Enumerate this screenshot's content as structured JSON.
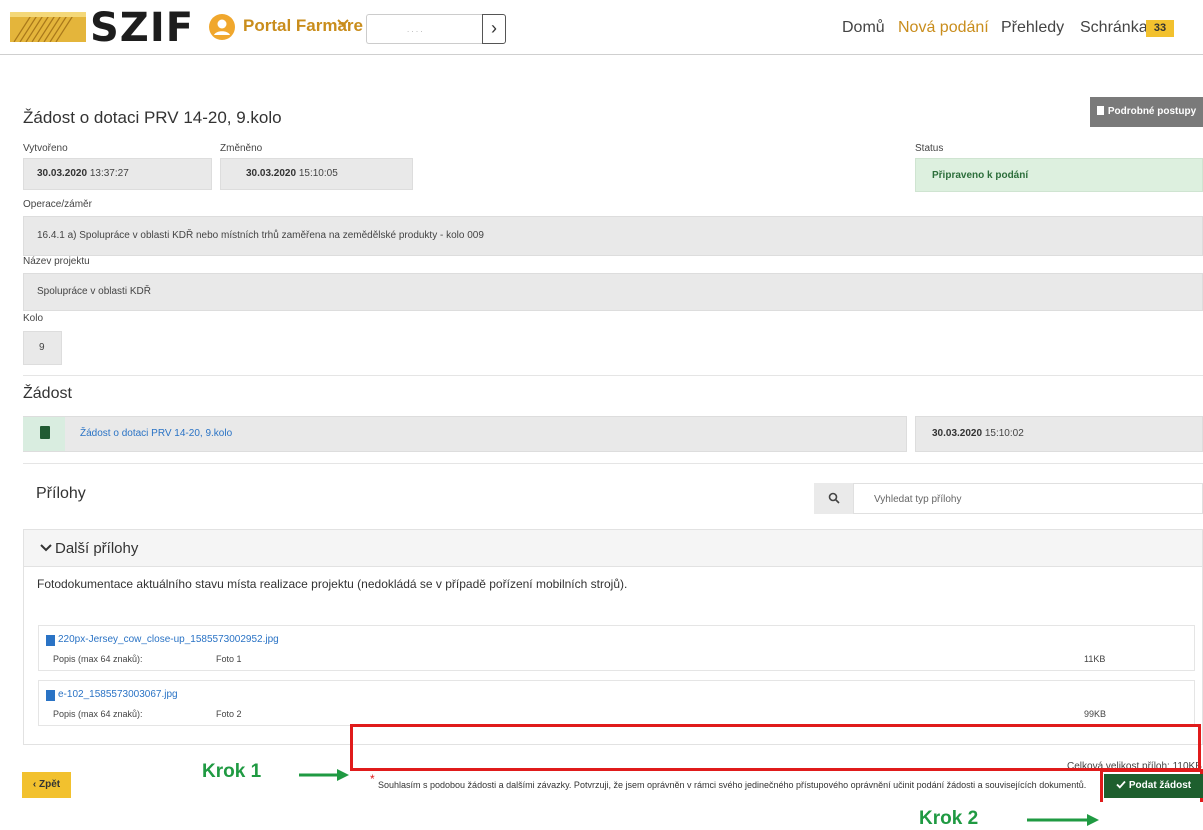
{
  "header": {
    "brand": "SZIF",
    "portal_label": "Portal Farmare",
    "portal_chevron": "chevron-down-icon",
    "search_placeholder": ". . . .",
    "go_icon": "chevron-right-icon",
    "nav": [
      "Domů",
      "Nová podání",
      "Přehledy",
      "Schránka"
    ],
    "active_nav": "Nová podání",
    "inbox_count": "33",
    "colors": {
      "brand_gold": "#c98d1c",
      "badge": "#f2c12e"
    }
  },
  "prv_button": "Podrobné postupy PRV",
  "page_title": "Žádost o dotaci PRV 14-20, 9.kolo",
  "meta": {
    "created_label": "Vytvořeno",
    "created_date": "30.03.2020",
    "created_time": "13:37:27",
    "changed_label": "Změněno",
    "changed_date": "30.03.2020",
    "changed_time": "15:10:05",
    "status_label": "Status",
    "status_value": "Připraveno k podání",
    "operation_label": "Operace/záměr",
    "operation_value": "16.4.1 a) Spolupráce v oblasti KDŘ nebo místních trhů zaměřena na zemědělské produkty - kolo 009",
    "project_label": "Název projektu",
    "project_value": "Spolupráce v oblasti KDŘ",
    "round_label": "Kolo",
    "round_value": "9"
  },
  "application": {
    "heading": "Žádost",
    "doc_link": "Žádost o dotaci PRV 14-20, 9.kolo",
    "doc_date": "30.03.2020",
    "doc_time": "15:10:02"
  },
  "attachments": {
    "heading": "Přílohy",
    "search_placeholder": "Vyhledat typ přílohy",
    "panel_title": "Další přílohy",
    "description": "Fotodokumentace aktuálního stavu místa realizace projektu (nedokládá se v případě pořízení mobilních strojů).",
    "files": [
      {
        "name": "220px-Jersey_cow_close-up_1585573002952.jpg",
        "desc_label": "Popis (max 64 znaků):",
        "desc_value": "Foto 1",
        "size": "11KB"
      },
      {
        "name": "e-102_1585573003067.jpg",
        "desc_label": "Popis (max 64 znaků):",
        "desc_value": "Foto 2",
        "size": "99KB"
      }
    ]
  },
  "consent": {
    "total_size": "Celková velikost příloh: 110KB",
    "asterisk": "*",
    "text": "Souhlasím s podobou žádosti a dalšími závazky. Potvrzuji, že jsem oprávněn v rámci svého jedinečného přístupového oprávnění učinit podání žádosti a souvisejících dokumentů.",
    "checked": true
  },
  "annotations": {
    "step1": "Krok 1",
    "step2": "Krok 2",
    "color": "#1f9a42",
    "frame_color": "#e01b1b"
  },
  "buttons": {
    "back": "Zpět",
    "submit": "Podat žádost"
  }
}
